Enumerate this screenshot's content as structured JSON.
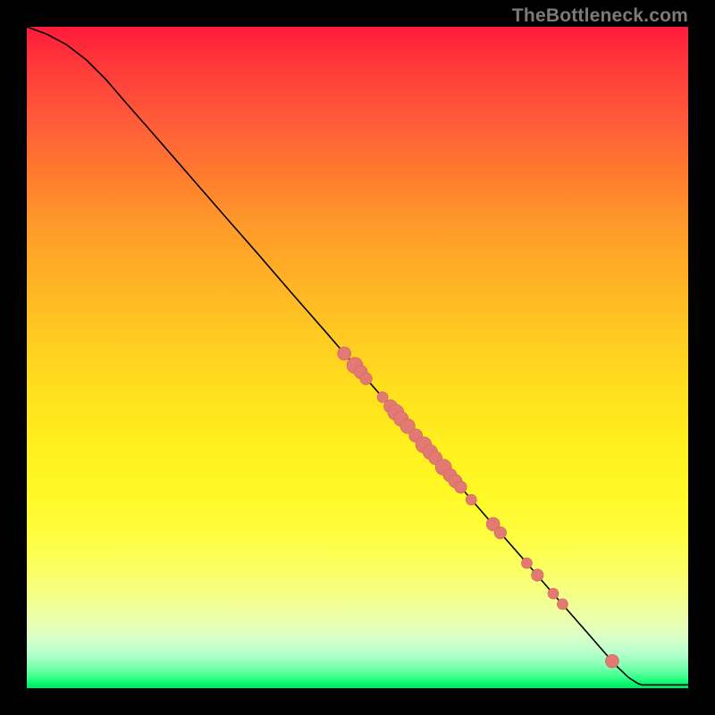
{
  "watermark": "TheBottleneck.com",
  "colors": {
    "curve": "#000000",
    "point_fill": "#e07a72",
    "point_stroke": "#d86c64"
  },
  "chart_data": {
    "type": "line",
    "title": "",
    "xlabel": "",
    "ylabel": "",
    "xlim": [
      0,
      100
    ],
    "ylim": [
      0,
      100
    ],
    "curve": [
      {
        "x": 0.0,
        "y": 100.0
      },
      {
        "x": 3.0,
        "y": 98.9
      },
      {
        "x": 6.0,
        "y": 97.3
      },
      {
        "x": 9.0,
        "y": 95.0
      },
      {
        "x": 12.0,
        "y": 92.0
      },
      {
        "x": 15.0,
        "y": 88.5
      },
      {
        "x": 18.0,
        "y": 85.1
      },
      {
        "x": 22.0,
        "y": 80.5
      },
      {
        "x": 26.0,
        "y": 75.9
      },
      {
        "x": 30.0,
        "y": 71.3
      },
      {
        "x": 35.0,
        "y": 65.6
      },
      {
        "x": 40.0,
        "y": 59.8
      },
      {
        "x": 45.0,
        "y": 54.1
      },
      {
        "x": 50.0,
        "y": 48.3
      },
      {
        "x": 55.0,
        "y": 42.6
      },
      {
        "x": 60.0,
        "y": 36.8
      },
      {
        "x": 65.0,
        "y": 31.1
      },
      {
        "x": 70.0,
        "y": 25.3
      },
      {
        "x": 75.0,
        "y": 19.6
      },
      {
        "x": 80.0,
        "y": 13.8
      },
      {
        "x": 85.0,
        "y": 8.1
      },
      {
        "x": 89.0,
        "y": 3.5
      },
      {
        "x": 91.0,
        "y": 1.6
      },
      {
        "x": 92.4,
        "y": 0.7
      },
      {
        "x": 93.0,
        "y": 0.5
      },
      {
        "x": 100.0,
        "y": 0.5
      }
    ],
    "points": [
      {
        "x": 48.0,
        "y": 50.6,
        "r": 1.0
      },
      {
        "x": 49.6,
        "y": 48.8,
        "r": 1.2
      },
      {
        "x": 50.5,
        "y": 47.8,
        "r": 1.0
      },
      {
        "x": 51.3,
        "y": 46.8,
        "r": 0.9
      },
      {
        "x": 53.8,
        "y": 44.0,
        "r": 0.8
      },
      {
        "x": 55.0,
        "y": 42.6,
        "r": 1.0
      },
      {
        "x": 55.8,
        "y": 41.7,
        "r": 1.2
      },
      {
        "x": 56.6,
        "y": 40.7,
        "r": 1.1
      },
      {
        "x": 57.6,
        "y": 39.6,
        "r": 1.1
      },
      {
        "x": 58.8,
        "y": 38.2,
        "r": 1.0
      },
      {
        "x": 60.0,
        "y": 36.8,
        "r": 1.2
      },
      {
        "x": 61.0,
        "y": 35.7,
        "r": 1.1
      },
      {
        "x": 61.8,
        "y": 34.8,
        "r": 1.0
      },
      {
        "x": 63.0,
        "y": 33.4,
        "r": 1.2
      },
      {
        "x": 64.0,
        "y": 32.2,
        "r": 1.0
      },
      {
        "x": 64.8,
        "y": 31.3,
        "r": 1.0
      },
      {
        "x": 65.6,
        "y": 30.4,
        "r": 0.9
      },
      {
        "x": 67.2,
        "y": 28.5,
        "r": 0.8
      },
      {
        "x": 70.5,
        "y": 24.8,
        "r": 1.0
      },
      {
        "x": 71.6,
        "y": 23.5,
        "r": 0.9
      },
      {
        "x": 75.6,
        "y": 18.9,
        "r": 0.8
      },
      {
        "x": 77.2,
        "y": 17.1,
        "r": 0.9
      },
      {
        "x": 79.6,
        "y": 14.3,
        "r": 0.8
      },
      {
        "x": 81.0,
        "y": 12.7,
        "r": 0.8
      },
      {
        "x": 88.5,
        "y": 4.1,
        "r": 1.0
      }
    ],
    "legend": null,
    "grid": false
  }
}
